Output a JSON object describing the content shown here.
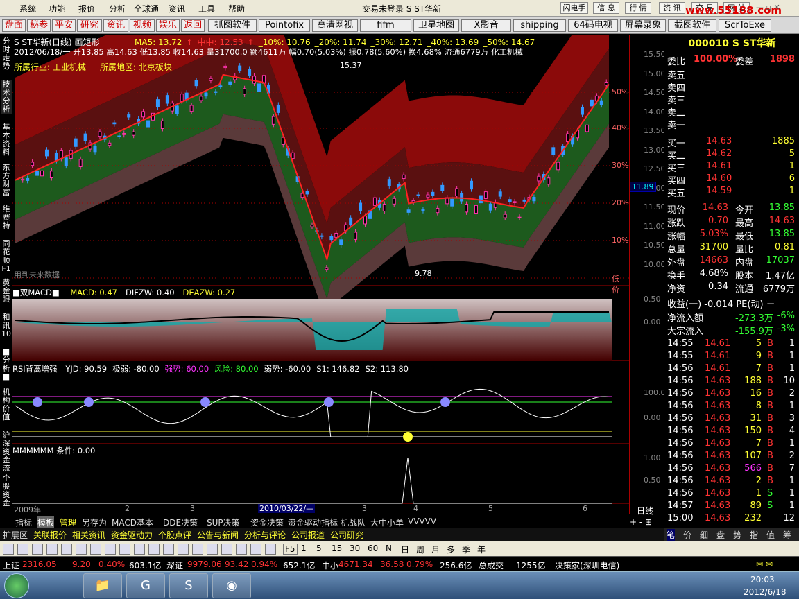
{
  "menu": {
    "items": [
      "系统",
      "功能",
      "报价",
      "分析",
      "全球通",
      "资讯",
      "工具",
      "帮助"
    ],
    "title": "交易未登录  S ST华新",
    "buttons": [
      "闪电手",
      "信 息",
      "行 情",
      "资 讯",
      "交 易",
      "网 站"
    ],
    "watermark": "www.55188.com"
  },
  "links": [
    "盘面",
    "秘参",
    "平安",
    "研究",
    "资讯",
    "视频",
    "娱乐",
    "返回",
    "抓图软件",
    "Pointofix",
    "高清网视",
    "fifm",
    "卫星地图",
    "X影音",
    "shipping",
    "64码电视",
    "屏幕录象",
    "截图软件",
    "ScrToExe"
  ],
  "left_tabs": [
    "分时走势",
    "技术分析",
    "基本资料",
    "东方财富",
    "维赛特",
    "同花顺F1",
    "黄金眼",
    "和讯10",
    "■分析■",
    "机构价值",
    "沪深资金流",
    "个股资金"
  ],
  "chart": {
    "title": "S ST华新(日线) 画矩形",
    "ma_info": [
      {
        "t": "MA5: 13.72",
        "c": "#ff3"
      },
      {
        "t": "↑",
        "c": "#f33"
      },
      {
        "t": "中中: 12.53",
        "c": "#f33"
      },
      {
        "t": "↑",
        "c": "#f33"
      },
      {
        "t": "_10%: 10.76",
        "c": "#ff3"
      },
      {
        "t": "_20%: 11.74",
        "c": "#ff3"
      },
      {
        "t": "_30%: 12.71",
        "c": "#ff3"
      },
      {
        "t": "_40%: 13.69",
        "c": "#ff3"
      },
      {
        "t": "_50%: 14.67",
        "c": "#ff3"
      }
    ],
    "info_line": "2012/06/18/一 开13.85 高14.63 低13.85 收14.63 量31700.0 额4611万 幅0.70(5.03%) 振0.78(5.60%) 换4.68% 流通6779万 化工机械",
    "industry": "所属行业: 工业机械",
    "region": "所属地区: 北京板块",
    "high_label": "15.37",
    "low_label": "9.78",
    "footer_note": "用到未来数据",
    "pct_labels": [
      "50%",
      "40%",
      "30%",
      "20%",
      "10%",
      "低价"
    ],
    "macd_title": "■双MACD■",
    "macd_vals": [
      {
        "t": "MACD: 0.47",
        "c": "#ff3"
      },
      {
        "t": "DIFZW: 0.40",
        "c": "#fff"
      },
      {
        "t": "DEAZW: 0.27",
        "c": "#ff3"
      }
    ],
    "rsi_title": "RSI背离增强",
    "rsi_vals": [
      {
        "t": "YJD: 90.59",
        "c": "#fff"
      },
      {
        "t": "极弱: -80.00",
        "c": "#fff"
      },
      {
        "t": "强势: 60.00",
        "c": "#f3f"
      },
      {
        "t": "风险: 80.00",
        "c": "#3f3"
      },
      {
        "t": "弱势: -60.00",
        "c": "#fff"
      },
      {
        "t": "S1: 146.82",
        "c": "#fff"
      },
      {
        "t": "S2: 113.80",
        "c": "#fff"
      }
    ],
    "mm_title": "MMMMMM",
    "mm_val": "条件: 0.00",
    "date_labels": [
      "2009年",
      "2",
      "3",
      "2010/03/22/—",
      "3",
      "4",
      "5",
      "6"
    ],
    "period": "日线"
  },
  "axis": {
    "main": [
      "15.50",
      "15.00",
      "14.50",
      "14.00",
      "13.50",
      "13.00",
      "12.50",
      "12.00",
      "11.50",
      "11.00",
      "10.50",
      "10.00"
    ],
    "current": "11.89",
    "macd": [
      "0.50",
      "0.00"
    ],
    "rsi": [
      "100.0",
      "0.00"
    ],
    "mm": [
      "1.00",
      "0.50"
    ]
  },
  "chart_data": {
    "type": "candlestick",
    "high": 15.37,
    "low": 9.78,
    "last_close": 14.63,
    "ma5": 13.72,
    "bands": {
      "10%": 10.76,
      "20%": 11.74,
      "30%": 12.71,
      "40%": 13.69,
      "50%": 14.67
    },
    "ylim": [
      10.0,
      15.5
    ]
  },
  "quote": {
    "code": "000010",
    "name": "S ST华新",
    "weibi_label": "委比",
    "weibi": "100.00%",
    "weicha_label": "委差",
    "weicha": "1898",
    "sells": [
      {
        "l": "卖五"
      },
      {
        "l": "卖四"
      },
      {
        "l": "卖三"
      },
      {
        "l": "卖二"
      },
      {
        "l": "卖一"
      }
    ],
    "buys": [
      {
        "l": "买一",
        "p": "14.63",
        "v": "1885"
      },
      {
        "l": "买二",
        "p": "14.62",
        "v": "5"
      },
      {
        "l": "买三",
        "p": "14.61",
        "v": "1"
      },
      {
        "l": "买四",
        "p": "14.60",
        "v": "6"
      },
      {
        "l": "买五",
        "p": "14.59",
        "v": "1"
      }
    ],
    "stats": [
      {
        "a": "现价",
        "av": "14.63",
        "ac": "#f33",
        "b": "今开",
        "bv": "13.85",
        "bc": "#3f3"
      },
      {
        "a": "涨跌",
        "av": "0.70",
        "ac": "#f33",
        "b": "最高",
        "bv": "14.63",
        "bc": "#f33"
      },
      {
        "a": "涨幅",
        "av": "5.03%",
        "ac": "#f33",
        "b": "最低",
        "bv": "13.85",
        "bc": "#3f3"
      },
      {
        "a": "总量",
        "av": "31700",
        "ac": "#ff3",
        "b": "量比",
        "bv": "0.81",
        "bc": "#ff3"
      },
      {
        "a": "外盘",
        "av": "14663",
        "ac": "#f33",
        "b": "内盘",
        "bv": "17037",
        "bc": "#3f3"
      },
      {
        "a": "换手",
        "av": "4.68%",
        "ac": "#fff",
        "b": "股本",
        "bv": "1.47亿",
        "bc": "#fff"
      },
      {
        "a": "净资",
        "av": "0.34",
        "ac": "#fff",
        "b": "流通",
        "bv": "6779万",
        "bc": "#fff"
      }
    ],
    "syi": "收益(一) -0.014 PE(动) －",
    "flow": [
      {
        "l": "净流入额",
        "v": "-273.3万",
        "p": "-6%"
      },
      {
        "l": "大宗流入",
        "v": "-155.9万",
        "p": "-3%"
      }
    ],
    "ticks": [
      {
        "t": "14:55",
        "p": "14.61",
        "v": "5",
        "s": "B",
        "n": "1",
        "vc": "#ff3",
        "sc": "#f33"
      },
      {
        "t": "14:55",
        "p": "14.61",
        "v": "9",
        "s": "B",
        "n": "1",
        "vc": "#ff3",
        "sc": "#f33"
      },
      {
        "t": "14:56",
        "p": "14.61",
        "v": "7",
        "s": "B",
        "n": "1",
        "vc": "#ff3",
        "sc": "#f33"
      },
      {
        "t": "14:56",
        "p": "14.63",
        "v": "188",
        "s": "B",
        "n": "10",
        "vc": "#ff3",
        "sc": "#f33"
      },
      {
        "t": "14:56",
        "p": "14.63",
        "v": "16",
        "s": "B",
        "n": "2",
        "vc": "#ff3",
        "sc": "#f33"
      },
      {
        "t": "14:56",
        "p": "14.63",
        "v": "8",
        "s": "B",
        "n": "1",
        "vc": "#ff3",
        "sc": "#f33"
      },
      {
        "t": "14:56",
        "p": "14.63",
        "v": "31",
        "s": "B",
        "n": "3",
        "vc": "#ff3",
        "sc": "#f33"
      },
      {
        "t": "14:56",
        "p": "14.63",
        "v": "150",
        "s": "B",
        "n": "4",
        "vc": "#ff3",
        "sc": "#f33"
      },
      {
        "t": "14:56",
        "p": "14.63",
        "v": "7",
        "s": "B",
        "n": "1",
        "vc": "#ff3",
        "sc": "#f33"
      },
      {
        "t": "14:56",
        "p": "14.63",
        "v": "107",
        "s": "B",
        "n": "2",
        "vc": "#ff3",
        "sc": "#f33"
      },
      {
        "t": "14:56",
        "p": "14.63",
        "v": "566",
        "s": "B",
        "n": "7",
        "vc": "#f3f",
        "sc": "#f33"
      },
      {
        "t": "14:56",
        "p": "14.63",
        "v": "2",
        "s": "B",
        "n": "1",
        "vc": "#ff3",
        "sc": "#f33"
      },
      {
        "t": "14:56",
        "p": "14.63",
        "v": "1",
        "s": "S",
        "n": "1",
        "vc": "#ff3",
        "sc": "#3f3"
      },
      {
        "t": "14:57",
        "p": "14.63",
        "v": "89",
        "s": "S",
        "n": "1",
        "vc": "#ff3",
        "sc": "#3f3"
      },
      {
        "t": "15:00",
        "p": "14.63",
        "v": "232",
        "s": "",
        "n": "12",
        "vc": "#ff3",
        "sc": "#f33"
      }
    ]
  },
  "subtabs": [
    "指标",
    "模板",
    "管理",
    "另存为",
    "MACD基本",
    "DDE决策",
    "SUP决策",
    "资金决策",
    "资金驱动指标",
    "机战队",
    "大中小单",
    "VVVVV"
  ],
  "bottomlinks": [
    "扩展区",
    "关联报价",
    "相关资讯",
    "资金驱动力",
    "个股点评",
    "公告与新闻",
    "分析与评论",
    "公司报道",
    "公司研究"
  ],
  "panelbtns": [
    "笔",
    "价",
    "细",
    "盘",
    "势",
    "指",
    "值",
    "筹"
  ],
  "toolbar2": {
    "periods": [
      "F5",
      "1",
      "5",
      "15",
      "30",
      "60",
      "N",
      "日",
      "周",
      "月",
      "多",
      "季",
      "年"
    ]
  },
  "status": {
    "sh_label": "上证",
    "sh": "2316.05",
    "sh_chg": "9.20",
    "sh_pct": "0.40%",
    "sh_amt": "603.1亿",
    "sz_label": "深证",
    "sz": "9979.06",
    "sz_chg": "93.42",
    "sz_pct": "0.94%",
    "sz_amt": "652.1亿",
    "zx_label": "中小",
    "zx": "4671.34",
    "zx_chg": "36.58",
    "zx_pct": "0.79%",
    "zx_amt": "256.6亿",
    "total_label": "总成交",
    "total": "1255亿",
    "source": "决策家(深圳电信)"
  },
  "taskbar": {
    "time": "20:03",
    "date": "2012/6/18"
  }
}
